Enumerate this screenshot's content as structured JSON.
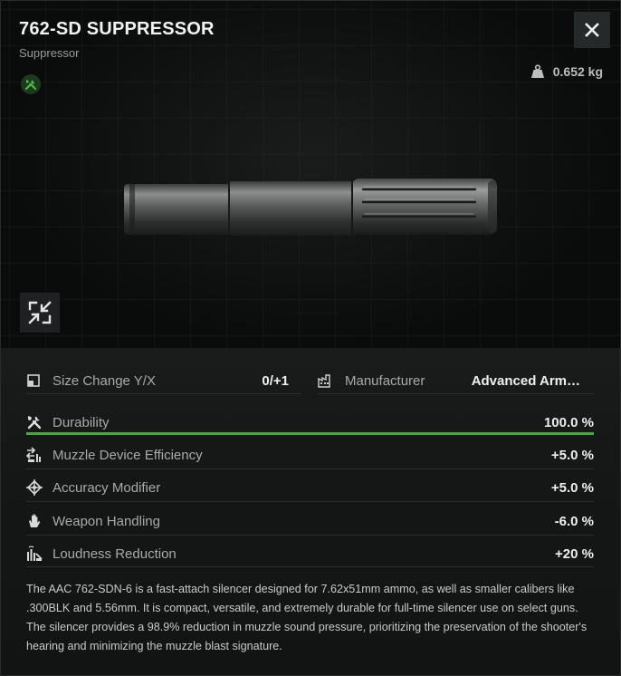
{
  "item": {
    "name": "762-SD SUPPRESSOR",
    "category": "Suppressor",
    "weight": "0.652 kg"
  },
  "icons": {
    "mod": "wrench-screwdriver-icon",
    "close": "close-icon",
    "weight": "weight-icon",
    "expand": "collapse-arrows-icon"
  },
  "info": {
    "size_label": "Size Change Y/X",
    "size_value": "0/+1",
    "manufacturer_label": "Manufacturer",
    "manufacturer_value": "Advanced Arm…"
  },
  "stats": [
    {
      "label": "Durability",
      "value": "100.0 %",
      "icon": "tools-icon",
      "bar": 1.0
    },
    {
      "label": "Muzzle Device Efficiency",
      "value": "+5.0 %",
      "icon": "muzzle-efficiency-icon"
    },
    {
      "label": "Accuracy Modifier",
      "value": "+5.0 %",
      "icon": "crosshair-icon"
    },
    {
      "label": "Weapon Handling",
      "value": "-6.0 %",
      "icon": "hand-icon"
    },
    {
      "label": "Loudness Reduction",
      "value": "+20 %",
      "icon": "loudness-icon"
    }
  ],
  "description": "The AAC 762-SDN-6 is a fast-attach silencer designed for 7.62x51mm ammo, as well as smaller calibers like .300BLK and 5.56mm. It is compact, versatile, and extremely durable for full-time silencer use on select guns. The silencer provides a 98.9% reduction in muzzle sound pressure, prioritizing the preservation of the shooter's hearing and minimizing the muzzle blast signature.",
  "colors": {
    "accent_green": "#4aa63f",
    "background": "#0d0e0e"
  }
}
